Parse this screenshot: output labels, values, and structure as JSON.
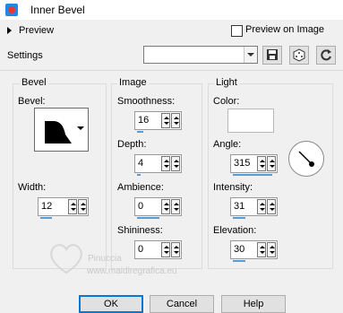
{
  "window": {
    "title": "Inner Bevel"
  },
  "preview": {
    "label": "Preview",
    "preview_on_image_label": "Preview on Image",
    "preview_on_image_checked": false
  },
  "settings": {
    "label": "Settings",
    "value": ""
  },
  "groups": {
    "bevel": {
      "title": "Bevel",
      "bevel_label": "Bevel:",
      "width_label": "Width:",
      "width_value": "12"
    },
    "image": {
      "title": "Image",
      "smoothness_label": "Smoothness:",
      "smoothness_value": "16",
      "depth_label": "Depth:",
      "depth_value": "4",
      "ambience_label": "Ambience:",
      "ambience_value": "0",
      "shininess_label": "Shininess:",
      "shininess_value": "0"
    },
    "light": {
      "title": "Light",
      "color_label": "Color:",
      "color_value": "#ffffff",
      "angle_label": "Angle:",
      "angle_value": "315",
      "intensity_label": "Intensity:",
      "intensity_value": "31",
      "elevation_label": "Elevation:",
      "elevation_value": "30"
    }
  },
  "buttons": {
    "ok": "OK",
    "cancel": "Cancel",
    "help": "Help"
  },
  "watermark": {
    "line1": "Pinuccia",
    "line2": "www.maidiregrafica.eu"
  }
}
